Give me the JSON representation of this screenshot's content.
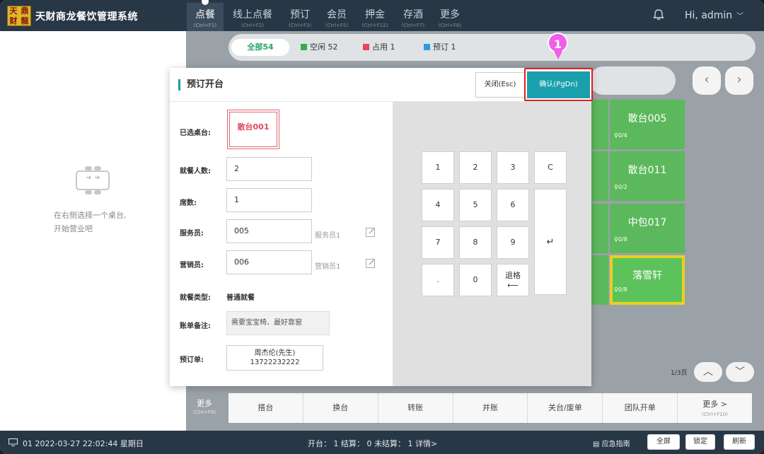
{
  "app": {
    "logo_chars": [
      "天",
      "鼎",
      "财",
      "龍"
    ],
    "name": "天财商龙餐饮管理系统"
  },
  "nav": {
    "tabs": [
      {
        "label": "点餐",
        "shortcut": "(Ctrl+F1)"
      },
      {
        "label": "线上点餐",
        "shortcut": "(Ctrl+F2)"
      },
      {
        "label": "预订",
        "shortcut": "(Ctrl+F3)"
      },
      {
        "label": "会员",
        "shortcut": "(Ctrl+F5)"
      },
      {
        "label": "押金",
        "shortcut": "(Ctrl+F12)"
      },
      {
        "label": "存酒",
        "shortcut": "(Ctrl+F7)"
      },
      {
        "label": "更多",
        "shortcut": "(Ctrl+F8)"
      }
    ],
    "user": "Hi, admin"
  },
  "left_panel": {
    "hint_line1": "在右侧选择一个桌台,",
    "hint_line2": "开始营业吧"
  },
  "filters": {
    "all": "全部54",
    "free": "空闲 52",
    "occupied": "占用 1",
    "reserved": "预订 1",
    "colors": {
      "free": "#2db24a",
      "occupied": "#e8455a",
      "reserved": "#2b9be0"
    }
  },
  "tables": [
    {
      "name": "散台005",
      "count": "0/4"
    },
    {
      "name": "散台011",
      "count": "0/2"
    },
    {
      "name": "中包017",
      "count": "0/8"
    },
    {
      "name": "落雪轩",
      "count": "0/8"
    }
  ],
  "pagination": {
    "page": "1/3页",
    "up": "︿",
    "down": "﹀",
    "prev": "‹",
    "next": "›"
  },
  "actions": {
    "more_left": {
      "label": "更多",
      "shortcut": "(Ctrl+F9)"
    },
    "items": [
      "搭台",
      "换台",
      "转账",
      "并账",
      "关台/废单",
      "团队开单"
    ],
    "more_right": {
      "label": "更多 >",
      "shortcut": "(Ctrl+F10)"
    }
  },
  "statusbar": {
    "datetime": "01 2022-03-27 22:02:44 星期日",
    "stats": "开台： 1   结算： 0   未结算： 1   详情>",
    "emergency": "应急指南",
    "fullscreen": "全屏",
    "lock": "锁定",
    "refresh": "刷新"
  },
  "dialog": {
    "title": "预订开台",
    "close_label": "关闭(Esc)",
    "confirm_label": "确认(PgDn)",
    "step_badge": "1",
    "fields": {
      "selected_label": "已选桌台:",
      "selected_value": "散台001",
      "guests_label": "就餐人数:",
      "guests_value": "2",
      "tables_label": "席数:",
      "tables_value": "1",
      "waiter_label": "服务员:",
      "waiter_value": "005",
      "waiter_name": "服务员1",
      "sales_label": "营销员:",
      "sales_value": "006",
      "sales_name": "营销员1",
      "dining_type_label": "就餐类型:",
      "dining_type_value": "普通就餐",
      "remark_label": "账单备注:",
      "remark_value": "需要宝宝椅、最好靠窗",
      "order_label": "预订单:",
      "order_name": "周杰伦(先生)",
      "order_phone": "13722232222"
    },
    "keypad": {
      "k1": "1",
      "k2": "2",
      "k3": "3",
      "kc": "C",
      "k4": "4",
      "k5": "5",
      "k6": "6",
      "k7": "7",
      "k8": "8",
      "k9": "9",
      "kenter": "↵",
      "kdot": ".",
      "k0": "0",
      "kbs": "退格",
      "kbs_arrow": "⟵"
    }
  }
}
